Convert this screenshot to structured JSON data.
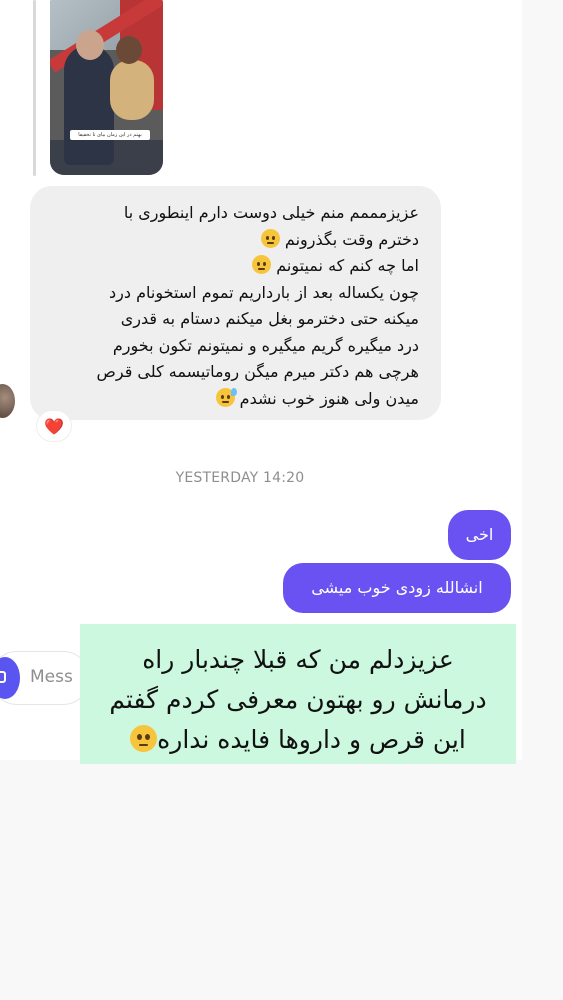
{
  "thread": {
    "shared_photo": {
      "caption": "بهتم در این زمان بیای تا تخفیفا"
    },
    "incoming_message": {
      "lines": [
        "عزیزمممم منم خیلی دوست دارم اینطوری با",
        "دخترم وقت بگذرونم",
        "اما چه کنم که نمیتونم",
        "چون یکساله بعد از بارداریم تموم استخونام درد",
        "میکنه حتی دخترمو بغل میکنم دستام به قدری",
        "درد میگیره گریم میگیره و نمیتونم تکون بخورم",
        "هرچی هم دکتر میرم میگن روماتیسمه کلی قرص",
        "میدن ولی هنوز خوب نشدم"
      ],
      "emojis": [
        "pleading-face",
        "melting-face",
        "downcast-sweat-face"
      ]
    },
    "reaction": {
      "symbol": "❤️",
      "icon": "heart-icon"
    },
    "timestamp": "YESTERDAY 14:20",
    "outgoing_messages": [
      {
        "text": "اخی"
      },
      {
        "text": "انشالله زودی خوب میشی"
      }
    ],
    "accent_color": "#6a52f2"
  },
  "composer": {
    "placeholder": "Mess"
  },
  "overlay_reply": {
    "lines": [
      "عزیزدلم من که قبلا چندبار راه",
      "درمانش رو بهتون معرفی کردم گفتم",
      "این قرص و داروها فایده نداره"
    ],
    "background": "#ccf8df"
  }
}
